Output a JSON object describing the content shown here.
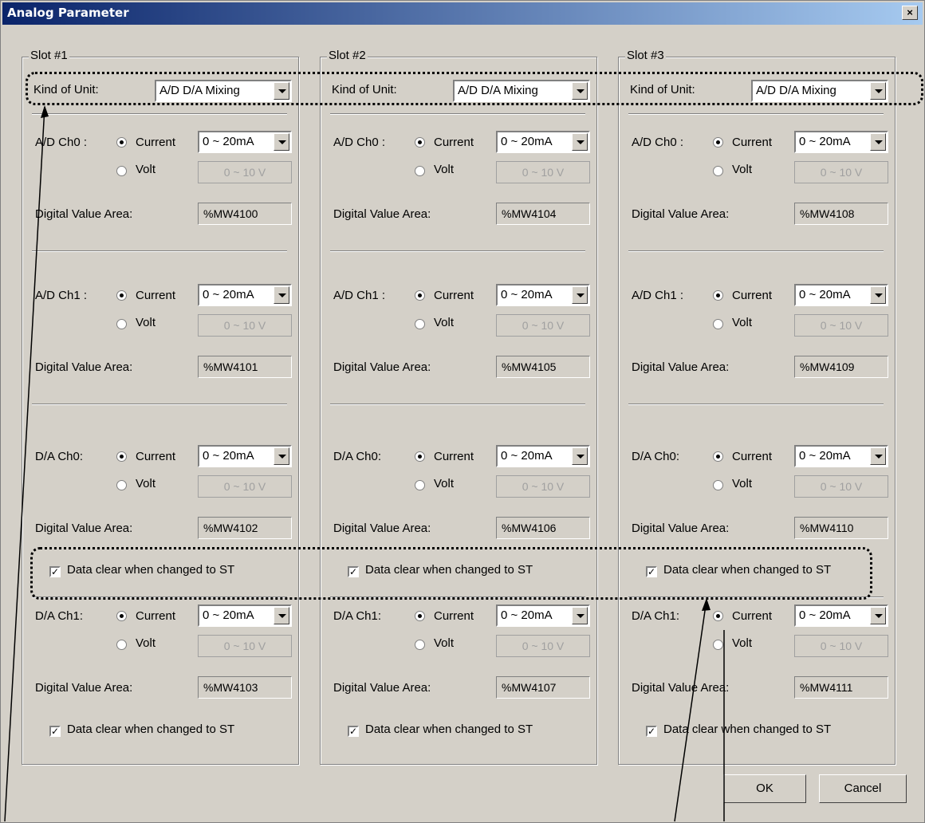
{
  "window": {
    "title": "Analog Parameter",
    "close_label": "×"
  },
  "slots": [
    {
      "title": "Slot #1",
      "kind_label": "Kind of Unit:",
      "kind_value": "A/D D/A Mixing",
      "channels": [
        {
          "name": "A/D Ch0 :",
          "current": "Current",
          "volt": "Volt",
          "range_current": "0 ~ 20mA",
          "range_volt": "0 ~ 10 V",
          "area_label": "Digital Value Area:",
          "area_value": "%MW4100"
        },
        {
          "name": "A/D Ch1 :",
          "current": "Current",
          "volt": "Volt",
          "range_current": "0 ~ 20mA",
          "range_volt": "0 ~ 10 V",
          "area_label": "Digital Value Area:",
          "area_value": "%MW4101"
        },
        {
          "name": "D/A Ch0:",
          "current": "Current",
          "volt": "Volt",
          "range_current": "0 ~ 20mA",
          "range_volt": "0 ~ 10 V",
          "area_label": "Digital Value Area:",
          "area_value": "%MW4102",
          "clear_label": "Data clear when changed to ST"
        },
        {
          "name": "D/A Ch1:",
          "current": "Current",
          "volt": "Volt",
          "range_current": "0 ~ 20mA",
          "range_volt": "0 ~ 10 V",
          "area_label": "Digital Value Area:",
          "area_value": "%MW4103",
          "clear_label": "Data clear when changed to ST"
        }
      ]
    },
    {
      "title": "Slot #2",
      "kind_label": "Kind of Unit:",
      "kind_value": "A/D D/A Mixing",
      "channels": [
        {
          "name": "A/D Ch0 :",
          "current": "Current",
          "volt": "Volt",
          "range_current": "0 ~ 20mA",
          "range_volt": "0 ~ 10 V",
          "area_label": "Digital Value Area:",
          "area_value": "%MW4104"
        },
        {
          "name": "A/D Ch1 :",
          "current": "Current",
          "volt": "Volt",
          "range_current": "0 ~ 20mA",
          "range_volt": "0 ~ 10 V",
          "area_label": "Digital Value Area:",
          "area_value": "%MW4105"
        },
        {
          "name": "D/A Ch0:",
          "current": "Current",
          "volt": "Volt",
          "range_current": "0 ~ 20mA",
          "range_volt": "0 ~ 10 V",
          "area_label": "Digital Value Area:",
          "area_value": "%MW4106",
          "clear_label": "Data clear when changed to ST"
        },
        {
          "name": "D/A Ch1:",
          "current": "Current",
          "volt": "Volt",
          "range_current": "0 ~ 20mA",
          "range_volt": "0 ~ 10 V",
          "area_label": "Digital Value Area:",
          "area_value": "%MW4107",
          "clear_label": "Data clear when changed to ST"
        }
      ]
    },
    {
      "title": "Slot #3",
      "kind_label": "Kind of Unit:",
      "kind_value": "A/D D/A Mixing",
      "channels": [
        {
          "name": "A/D Ch0 :",
          "current": "Current",
          "volt": "Volt",
          "range_current": "0 ~ 20mA",
          "range_volt": "0 ~ 10 V",
          "area_label": "Digital Value Area:",
          "area_value": "%MW4108"
        },
        {
          "name": "A/D Ch1 :",
          "current": "Current",
          "volt": "Volt",
          "range_current": "0 ~ 20mA",
          "range_volt": "0 ~ 10 V",
          "area_label": "Digital Value Area:",
          "area_value": "%MW4109"
        },
        {
          "name": "D/A Ch0:",
          "current": "Current",
          "volt": "Volt",
          "range_current": "0 ~ 20mA",
          "range_volt": "0 ~ 10 V",
          "area_label": "Digital Value Area:",
          "area_value": "%MW4110",
          "clear_label": "Data clear when changed to ST"
        },
        {
          "name": "D/A Ch1:",
          "current": "Current",
          "volt": "Volt",
          "range_current": "0 ~ 20mA",
          "range_volt": "0 ~ 10 V",
          "area_label": "Digital Value Area:",
          "area_value": "%MW4111",
          "clear_label": "Data clear when changed to ST"
        }
      ]
    }
  ],
  "buttons": {
    "ok": "OK",
    "cancel": "Cancel"
  }
}
